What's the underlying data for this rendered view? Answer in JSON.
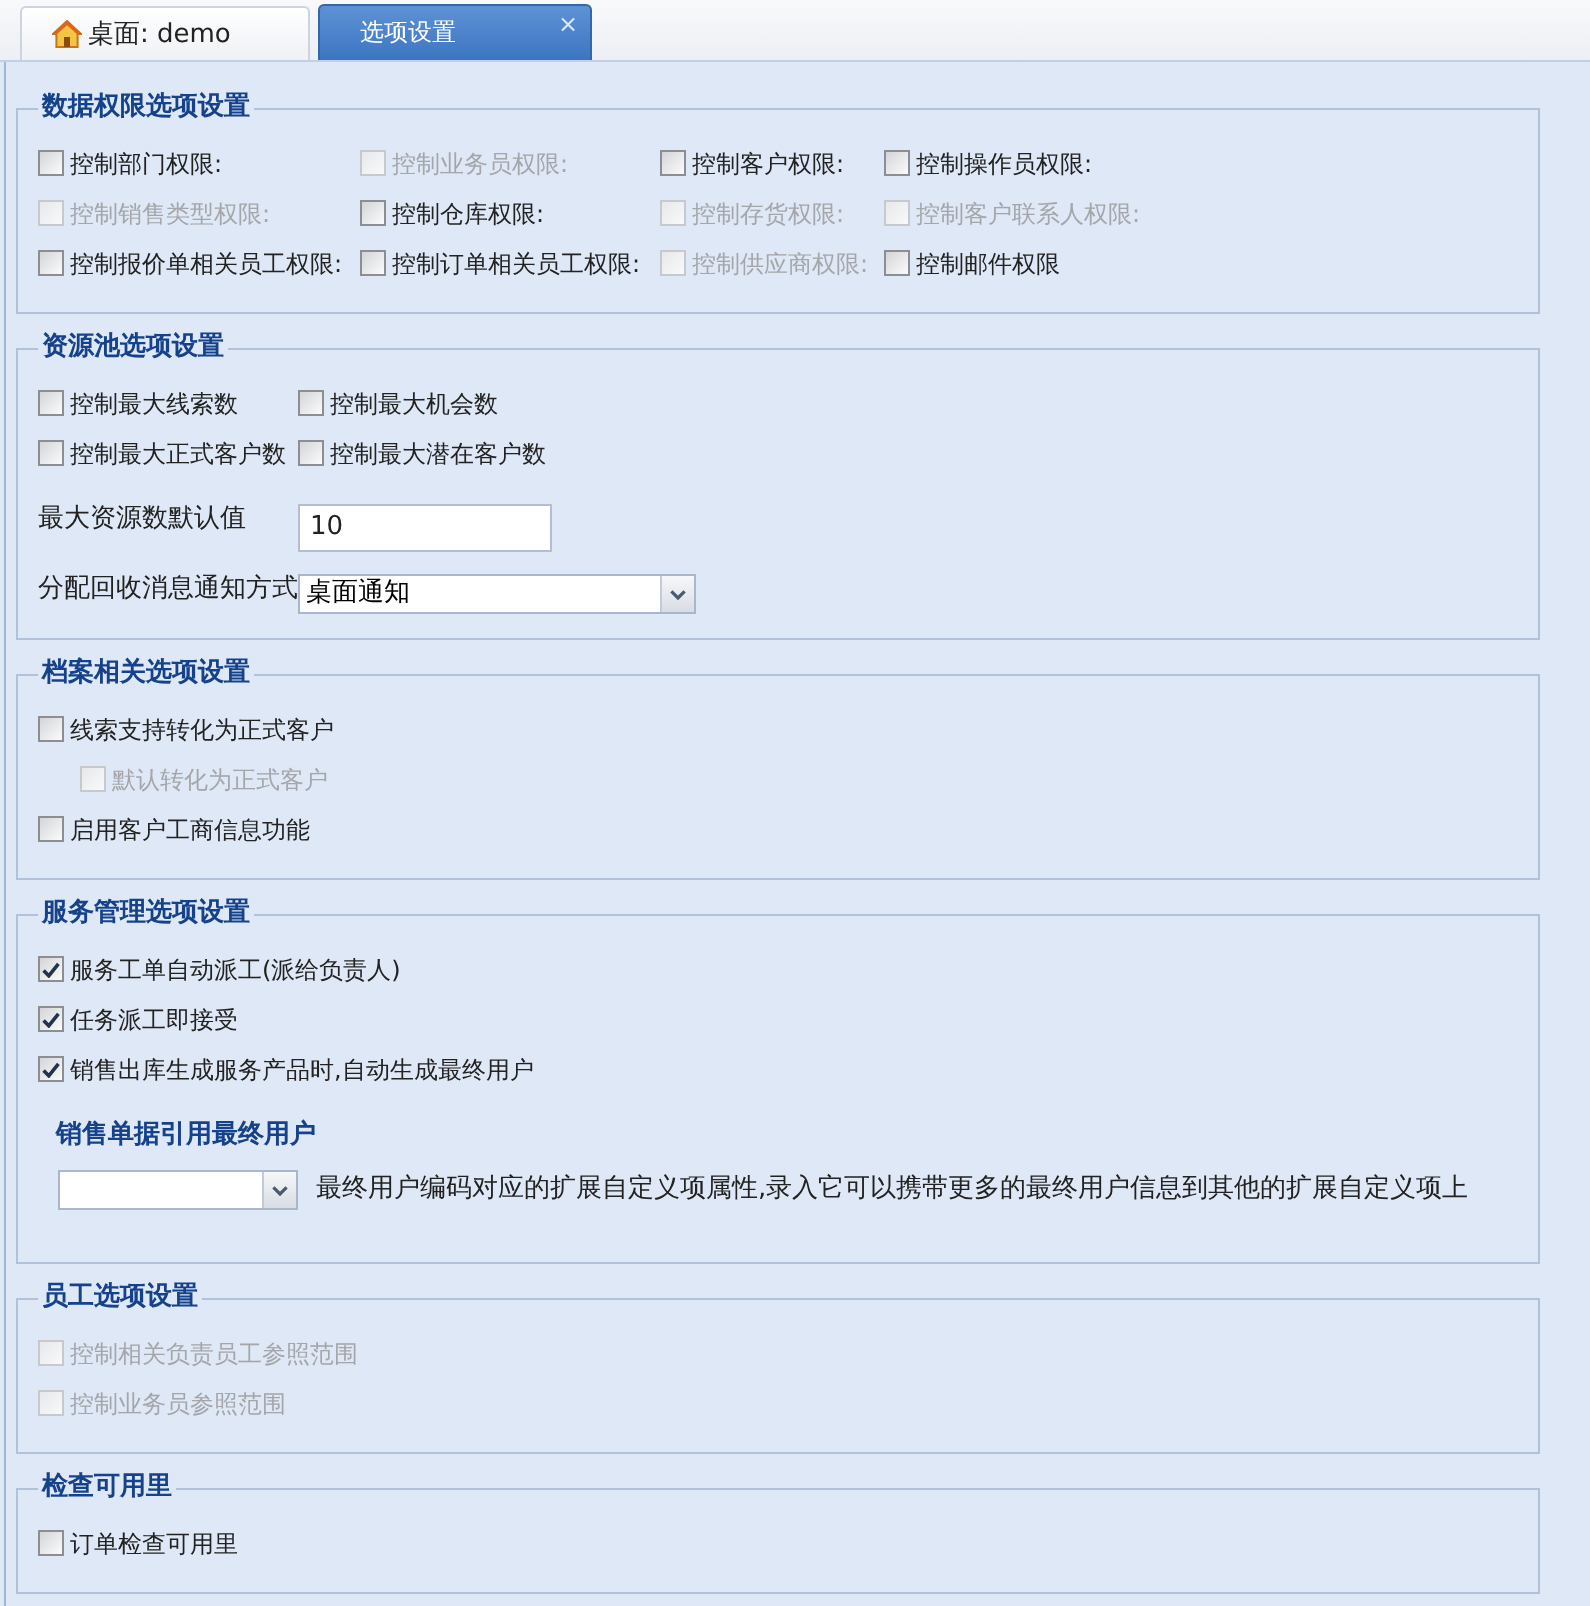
{
  "tabs": [
    {
      "kind": "home",
      "label": "桌面: demo",
      "selected": false
    },
    {
      "kind": "page",
      "label": "选项设置",
      "selected": true,
      "close": "×"
    }
  ],
  "sections": [
    {
      "title": "数据权限选项设置",
      "items": [
        {
          "kind": "checkbox_grid",
          "rows": [
            [
              {
                "label": "控制部门权限:",
                "checked": false,
                "disabled": false
              },
              {
                "label": "控制业务员权限:",
                "checked": false,
                "disabled": true
              },
              {
                "label": "控制客户权限:",
                "checked": false,
                "disabled": false
              },
              {
                "label": "控制操作员权限:",
                "checked": false,
                "disabled": false
              }
            ],
            [
              {
                "label": "控制销售类型权限:",
                "checked": false,
                "disabled": true
              },
              {
                "label": "控制仓库权限:",
                "checked": false,
                "disabled": false
              },
              {
                "label": "控制存货权限:",
                "checked": false,
                "disabled": true
              },
              {
                "label": "控制客户联系人权限:",
                "checked": false,
                "disabled": true
              }
            ],
            [
              {
                "label": "控制报价单相关员工权限:",
                "checked": false,
                "disabled": false
              },
              {
                "label": "控制订单相关员工权限:",
                "checked": false,
                "disabled": false
              },
              {
                "label": "控制供应商权限:",
                "checked": false,
                "disabled": true
              },
              {
                "label": "控制邮件权限",
                "checked": false,
                "disabled": false
              }
            ]
          ]
        }
      ]
    },
    {
      "title": "资源池选项设置",
      "items": [
        {
          "kind": "checkbox_grid",
          "rows": [
            [
              {
                "label": "控制最大线索数",
                "checked": false,
                "disabled": false
              },
              {
                "label": "控制最大机会数",
                "checked": false,
                "disabled": false
              }
            ],
            [
              {
                "label": "控制最大正式客户数",
                "checked": false,
                "disabled": false
              },
              {
                "label": "控制最大潜在客户数",
                "checked": false,
                "disabled": false
              }
            ]
          ]
        },
        {
          "kind": "text_field",
          "label": "最大资源数默认值",
          "value": "10"
        },
        {
          "kind": "select",
          "label": "分配回收消息通知方式",
          "value": "桌面通知"
        }
      ]
    },
    {
      "title": "档案相关选项设置",
      "items": [
        {
          "kind": "checkbox",
          "label": "线索支持转化为正式客户",
          "checked": false,
          "disabled": false,
          "children": [
            {
              "kind": "checkbox",
              "label": "默认转化为正式客户",
              "checked": false,
              "disabled": true
            }
          ]
        },
        {
          "kind": "checkbox",
          "label": "启用客户工商信息功能",
          "checked": false,
          "disabled": false
        }
      ]
    },
    {
      "title": "服务管理选项设置",
      "items": [
        {
          "kind": "checkbox",
          "label": "服务工单自动派工(派给负责人)",
          "checked": true,
          "disabled": false
        },
        {
          "kind": "checkbox",
          "label": "任务派工即接受",
          "checked": true,
          "disabled": false
        },
        {
          "kind": "checkbox",
          "label": "销售出库生成服务产品时,自动生成最终用户",
          "checked": true,
          "disabled": false
        },
        {
          "kind": "subheading",
          "text": "销售单据引用最终用户"
        },
        {
          "kind": "select_with_note",
          "note": "最终用户编码对应的扩展自定义项属性,录入它可以携带更多的最终用户信息到其他的扩展自定义项上"
        }
      ]
    },
    {
      "title": "员工选项设置",
      "items": [
        {
          "kind": "checkbox",
          "label": "控制相关负责员工参照范围",
          "checked": false,
          "disabled": true
        },
        {
          "kind": "checkbox",
          "label": "控制业务员参照范围",
          "checked": false,
          "disabled": true
        }
      ]
    },
    {
      "title": "检查可用里",
      "items": [
        {
          "kind": "checkbox",
          "label": "订单检查可用里",
          "checked": false,
          "disabled": false
        }
      ]
    }
  ]
}
